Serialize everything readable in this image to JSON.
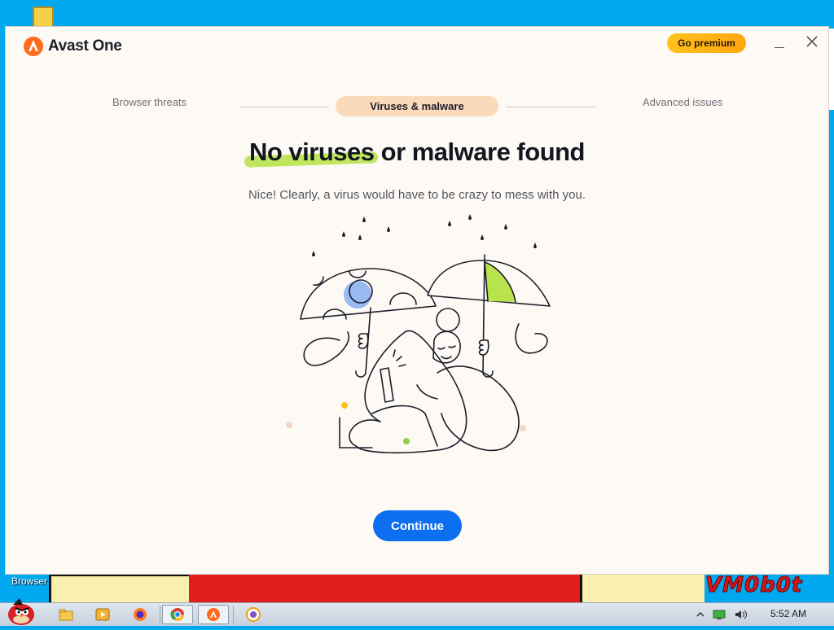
{
  "app": {
    "name": "Avast One",
    "premium_label": "Go premium"
  },
  "window_controls": {
    "minimize": "—",
    "close": "✕"
  },
  "stepper": {
    "steps": [
      {
        "label": "Browser threats",
        "state": "done"
      },
      {
        "label": "Viruses & malware",
        "state": "active"
      },
      {
        "label": "Advanced issues",
        "state": "pending"
      }
    ]
  },
  "result": {
    "title_highlight": "No viruses",
    "title_rest": " or malware found",
    "subtitle": "Nice! Clearly, a virus would have to be crazy to mess with you."
  },
  "actions": {
    "continue_label": "Continue"
  },
  "desktop": {
    "shortcut_label": "Browser",
    "watermark": "VM0b0t"
  },
  "taskbar": {
    "items": [
      "folder-icon",
      "media-player-icon",
      "firefox-icon",
      "chrome-icon",
      "avast-icon",
      "browser-icon"
    ],
    "clock": "5:52 AM"
  },
  "colors": {
    "accent": "#0c6ff0",
    "brand": "#ff6b1a",
    "highlight": "#b9e34c",
    "active_step": "#fbd9bb",
    "premium": "#ffb715"
  }
}
